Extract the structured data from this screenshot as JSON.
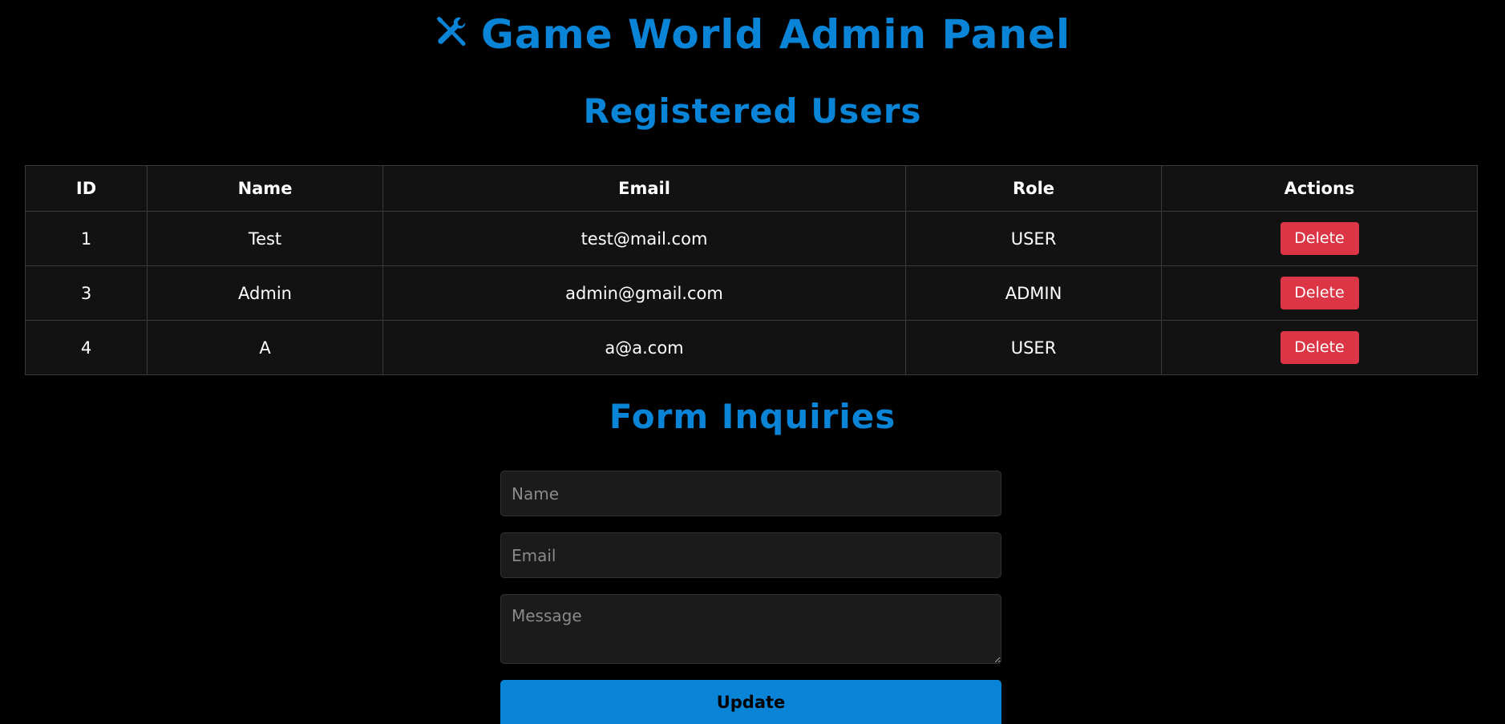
{
  "header": {
    "title": "Game World Admin Panel",
    "icon": "tools-icon"
  },
  "users_section": {
    "title": "Registered Users",
    "columns": [
      "ID",
      "Name",
      "Email",
      "Role",
      "Actions"
    ],
    "rows": [
      {
        "id": "1",
        "name": "Test",
        "email": "test@mail.com",
        "role": "USER",
        "action": "Delete"
      },
      {
        "id": "3",
        "name": "Admin",
        "email": "admin@gmail.com",
        "role": "ADMIN",
        "action": "Delete"
      },
      {
        "id": "4",
        "name": "A",
        "email": "a@a.com",
        "role": "USER",
        "action": "Delete"
      }
    ]
  },
  "inquiries_section": {
    "title": "Form Inquiries",
    "name_placeholder": "Name",
    "name_value": "",
    "email_placeholder": "Email",
    "email_value": "",
    "message_placeholder": "Message",
    "message_value": "",
    "submit_label": "Update"
  },
  "colors": {
    "background": "#000000",
    "accent": "#0a84d6",
    "danger": "#dc3545",
    "table_bg": "#121212",
    "field_bg": "#1b1b1b"
  }
}
